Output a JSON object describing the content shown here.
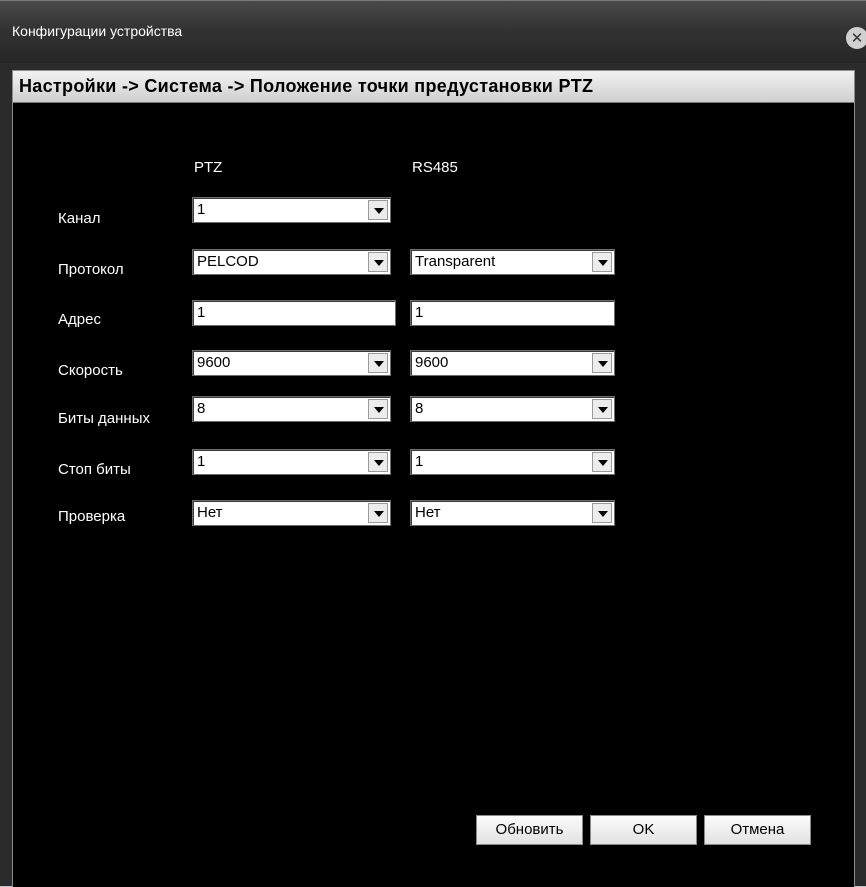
{
  "window": {
    "title": "Конфигурации устройства",
    "close_glyph": "✕"
  },
  "breadcrumb": "Настройки -> Система -> Положение точки предустановки PTZ",
  "columns": {
    "ptz": "PTZ",
    "rs485": "RS485"
  },
  "rows": {
    "channel": {
      "label": "Канал",
      "ptz": "1"
    },
    "protocol": {
      "label": "Протокол",
      "ptz": "PELCOD",
      "rs485": "Transparent"
    },
    "address": {
      "label": "Адрес",
      "ptz": "1",
      "rs485": "1"
    },
    "speed": {
      "label": "Скорость",
      "ptz": "9600",
      "rs485": "9600"
    },
    "data_bits": {
      "label": "Биты данных",
      "ptz": "8",
      "rs485": "8"
    },
    "stop_bits": {
      "label": "Стоп биты",
      "ptz": "1",
      "rs485": "1"
    },
    "parity": {
      "label": "Проверка",
      "ptz": "Нет",
      "rs485": "Нет"
    }
  },
  "buttons": {
    "refresh": "Обновить",
    "ok": "OK",
    "cancel": "Отмена"
  },
  "icons": {
    "dropdown": "chevron-down-icon",
    "close": "close-icon"
  }
}
